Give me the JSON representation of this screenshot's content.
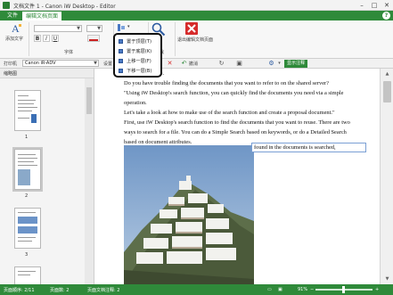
{
  "window": {
    "title": "文档文件 1 - Canon iW Desktop - Editor",
    "controls": [
      "–",
      "□",
      "✕"
    ]
  },
  "ribbon_tabs": [
    {
      "label": "文件"
    },
    {
      "label": "编辑文档页面",
      "active": true
    }
  ],
  "help_label": "?",
  "ribbon": {
    "add_text_label": "添加文字",
    "font_group_label": "字体",
    "bold": "B",
    "italic": "I",
    "underline": "U",
    "annotations_label": "注释",
    "search_group_label": "查找",
    "exit_label": "退出编辑文档页面"
  },
  "subbar": {
    "printer_label": "打印机",
    "printer_value": "Canon iR-ADV",
    "settings_label": "设置",
    "undo_label": "撤消",
    "show_annotations_label": "显示注释"
  },
  "thumbnails": {
    "header": "缩略图",
    "pages": [
      "1",
      "2",
      "3"
    ]
  },
  "document": {
    "lines": [
      "Do you have trouble finding the documents that you want to refer to on the shared server?",
      "\"Using iW Desktop's search function, you can quickly find the documents you need via a simple",
      "operation.",
      "Let's take a look at how to make use of the search function and create a proposal document.\"",
      "First, use iW Desktop's search function to find the documents that you want to reuse. There are two",
      "ways to search for a file. You can do a Simple Search based on keywords, or do a Detailed Search",
      "based on document attributes."
    ],
    "textbox": "found in the documents is searched,"
  },
  "context_menu": {
    "items": [
      "置于顶层(T)",
      "置于底层(K)",
      "上移一层(F)",
      "下移一层(B)"
    ]
  },
  "status": {
    "page": "页面顺序: 2/11",
    "count": "页面数: 2",
    "annotations": "页面文档注释: 2",
    "zoom": "91%",
    "right": "页面文档注释: 2"
  },
  "colors": {
    "accent": "#2f8a3a",
    "menu_icon": "#4a79c4"
  }
}
